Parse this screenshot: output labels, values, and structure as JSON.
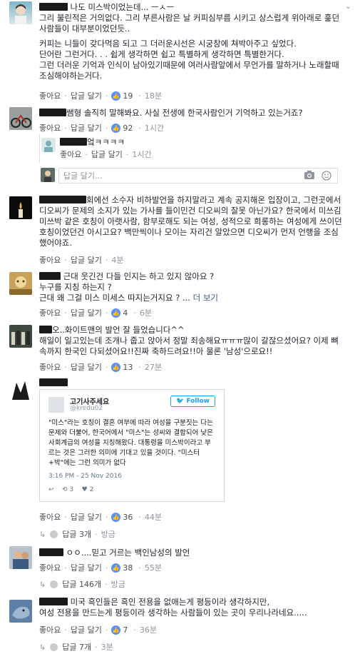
{
  "labels": {
    "like": "좋아요",
    "reply": "답글 달기",
    "dot": "·",
    "more": "더 보기",
    "reply_placeholder": "답글 달기...",
    "just_now": "방금"
  },
  "comments": [
    {
      "name": "",
      "lines": [
        "나도 미스박이었는데... ㅡㅅㅡ",
        "그리 불린적은 거의없다. 그리 부른사람은 날 커피심부름 시키고 상스럽게 위아래로 훑던 사람들이 대부분이었던듯..",
        "",
        "커피는 니들이 갖다먹음 되고 그 더러운시선은 시궁창에 쳐박아주고 싶었다.",
        "단어란 그런거다. . . 쉽게 생각하면 쉽고 특별하게 생각하면 특별한거다.",
        "그런 더러운 기억과 인식이 남아있기때문에 여러사람앞에서 무언가를 말하거나 노래할때 조심해야하는거다."
      ],
      "likes": "19",
      "time": "18분"
    },
    {
      "text": "쌤형 솔직히 말해봐요. 사실 전생에 한국사람인거 기억하고 있는거죠?",
      "likes": "92",
      "time": "1시간"
    },
    {
      "text": "엌ㅋㅋㅋㅋ",
      "time": "1시간"
    },
    {
      "lines": [
        "회에선 소수자 비하발언을 하지말라고 계속 공지해온 입장이고, 그런곳에서 디오씨가 문제의 소지가 있는 가사를 들이민건 디오씨의 잘못 아닌가요? 한국에서 미쓰김 미쓰박 같은 호칭이 아랫사람, 함부로해도 되는 여성, 성적으로 희롱하는 여성에게 쓰이던 호칭이었던건 아시고요? 백만씩이나 모이는 자리건 알았으면 디오씨가 먼저 언행을 조심했어야죠."
      ],
      "time": "4분"
    },
    {
      "lines": [
        "근대 웃긴건 다들 인지는 하고 있지 않아요 ?",
        "누구를 지칭 하는지 ?",
        "근대 왜 그걸 미스 미세스 따지는거지요 ? ..."
      ],
      "likes": "4",
      "time": "6분"
    },
    {
      "lines": [
        "오..화이트맨의 발언 잘 들었습니다^^",
        "해일이 일고있는데 조개나 줍고 앉아서 정말 죄송해요ㅠㅠㅠ많이 갈잖으셨어요? 이제 뼈속까지 한국인 다되셨어요!!진짜 축하드려요!!아 물론 '남성'으로요!!"
      ],
      "likes": "13",
      "time": "27분"
    },
    {
      "likes": "36",
      "time": "44분",
      "replies": "답글 3개",
      "reply_time": "방금"
    },
    {
      "text": "ㅇㅇ....믿고 거르는 백인남성의 발언",
      "likes": "38",
      "time": "55분",
      "replies": "답글 146개",
      "reply_time": "방금"
    },
    {
      "lines": [
        "미국 흑인들은 흑인 전용을 없애는게 평등이라 생각하지만,",
        "여성 전용을 만드는게 평등이라 생각하는 사람들이 있는 곳이 우리나라네요....."
      ],
      "likes": "7",
      "time": "36분",
      "replies": "답글 7개",
      "reply_time": "3분"
    }
  ],
  "tweet": {
    "name": "고기사주세요",
    "handle": "@kredu02",
    "follow": "Follow",
    "text": "\"미스\"라는 호칭이 결혼 여부에 따라 여성을 구분짓는 다는 문제와 더불어, 한국어에서 \"미스\"는 성씨와 결합되어 낮은 사회계급의 여성을 지칭해왔다. 대통령을 미스박이라고 부르는 것은 그러한 의미에 기대고 있을 것이다. \"미스터+박\"에는 그런 의미가 없다",
    "date": "3:16 PM - 25 Nov 2016",
    "retweets": "3",
    "likes": "2"
  }
}
